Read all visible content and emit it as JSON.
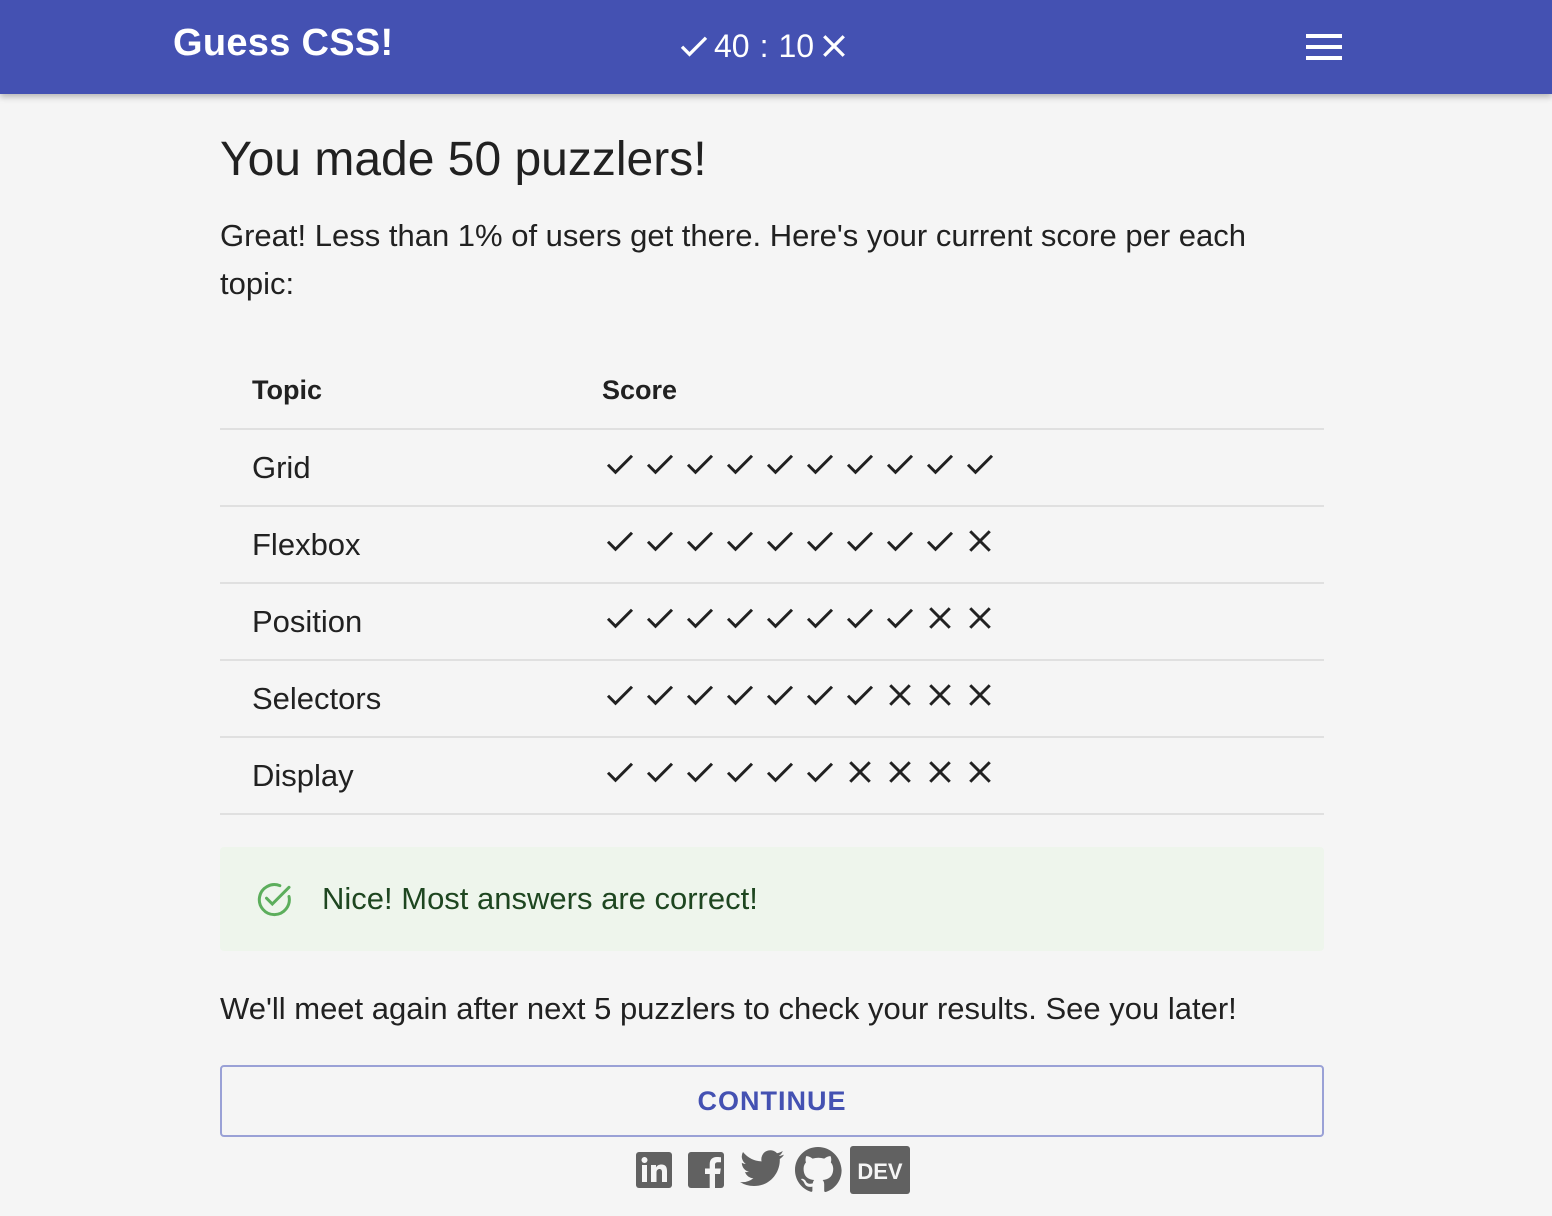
{
  "app": {
    "title": "Guess CSS!",
    "correct_count": "40",
    "separator": ":",
    "wrong_count": "10"
  },
  "colors": {
    "appbar": "#4451b2",
    "background": "#f5f5f5",
    "success_bg": "#eef5ec",
    "success_icon": "#5cae5c",
    "mark": "#212121",
    "button_text": "#4451b2"
  },
  "icons": {
    "menu": "hamburger-menu-icon",
    "correct": "check-icon",
    "wrong": "cross-icon",
    "alert": "check-circle-outline-icon"
  },
  "main": {
    "heading": "You made 50 puzzlers!",
    "intro": "Great! Less than 1% of users get there. Here's your current score per each topic:",
    "table": {
      "headers": [
        "Topic",
        "Score"
      ],
      "rows": [
        {
          "topic": "Grid",
          "marks": [
            1,
            1,
            1,
            1,
            1,
            1,
            1,
            1,
            1,
            1
          ]
        },
        {
          "topic": "Flexbox",
          "marks": [
            1,
            1,
            1,
            1,
            1,
            1,
            1,
            1,
            1,
            0
          ]
        },
        {
          "topic": "Position",
          "marks": [
            1,
            1,
            1,
            1,
            1,
            1,
            1,
            1,
            0,
            0
          ]
        },
        {
          "topic": "Selectors",
          "marks": [
            1,
            1,
            1,
            1,
            1,
            1,
            1,
            0,
            0,
            0
          ]
        },
        {
          "topic": "Display",
          "marks": [
            1,
            1,
            1,
            1,
            1,
            1,
            0,
            0,
            0,
            0
          ]
        }
      ]
    },
    "alert": "Nice! Most answers are correct!",
    "note": "We'll meet again after next 5 puzzlers to check your results. See you later!",
    "continue_label": "CONTINUE"
  },
  "footer": {
    "social": [
      {
        "name": "linkedin-icon"
      },
      {
        "name": "facebook-icon"
      },
      {
        "name": "twitter-icon"
      },
      {
        "name": "github-icon"
      },
      {
        "name": "dev-icon",
        "label": "DEV"
      }
    ]
  }
}
